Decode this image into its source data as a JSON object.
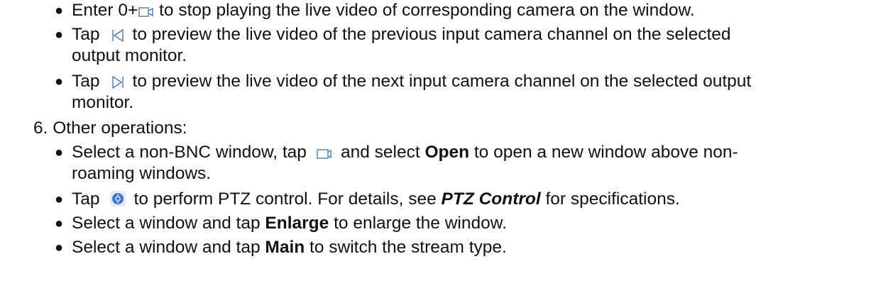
{
  "items": {
    "stop": {
      "a": "Enter 0+",
      "b": " to stop playing the live video of corresponding camera on the window.",
      "icon": "camera-icon"
    },
    "prev": {
      "a": "Tap",
      "b": "to preview the live video of the previous input camera channel on the selected",
      "c": "output monitor.",
      "icon": "previous-channel-icon"
    },
    "next": {
      "a": "Tap",
      "b": "to preview the live video of the next input camera channel on the selected output",
      "c": "monitor.",
      "icon": "next-channel-icon"
    }
  },
  "step6": {
    "heading": "6. Other operations:",
    "open": {
      "a": "Select a non-BNC window, tap",
      "b": "and select",
      "c": "Open",
      "d": "to open a new window above non-",
      "e": "roaming windows.",
      "icon": "camera-icon"
    },
    "ptz": {
      "a": "Tap",
      "b": "to perform PTZ control. For details, see",
      "c": "PTZ Control",
      "d": "for specifications.",
      "icon": "ptz-control-icon"
    },
    "enlarge": {
      "a": "Select a window and tap",
      "b": "Enlarge",
      "c": "to enlarge the window."
    },
    "main": {
      "a": "Select a window and tap",
      "b": "Main",
      "c": "to switch the stream type."
    }
  },
  "bullet_char": "●",
  "colors": {
    "text": "#111111",
    "icon_stroke": "#4a78b8",
    "ptz_fill": "#3d78d8"
  }
}
